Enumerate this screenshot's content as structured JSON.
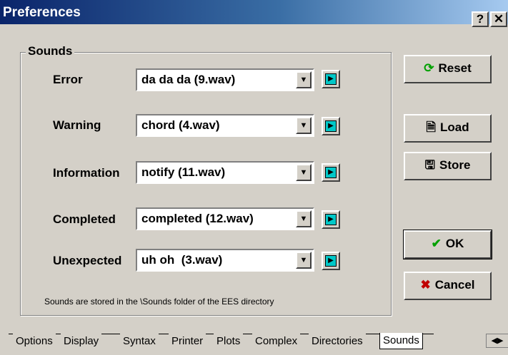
{
  "window": {
    "title": "Preferences",
    "help_label": "?",
    "close_label": "✕"
  },
  "group": {
    "label": "Sounds"
  },
  "rows": [
    {
      "label": "Error",
      "value": "da da da (9.wav)"
    },
    {
      "label": "Warning",
      "value": "chord (4.wav)"
    },
    {
      "label": "Information",
      "value": "notify (11.wav)"
    },
    {
      "label": "Completed",
      "value": "completed (12.wav)"
    },
    {
      "label": "Unexpected",
      "value": "uh oh  (3.wav)"
    }
  ],
  "note": "Sounds are stored in the \\Sounds folder of the EES directory",
  "buttons": {
    "reset": {
      "label": "Reset",
      "icon": "refresh-icon",
      "color": "#00a000"
    },
    "load": {
      "label": "Load",
      "icon": "document-icon"
    },
    "store": {
      "label": "Store",
      "icon": "save-icon"
    },
    "ok": {
      "label": "OK",
      "icon": "check-icon",
      "color": "#00a000"
    },
    "cancel": {
      "label": "Cancel",
      "icon": "x-icon",
      "color": "#c00000"
    }
  },
  "tabs": [
    "Options",
    "Display",
    "Syntax",
    "Printer",
    "Plots",
    "Complex",
    "Directories",
    "Sounds"
  ],
  "active_tab": "Sounds"
}
